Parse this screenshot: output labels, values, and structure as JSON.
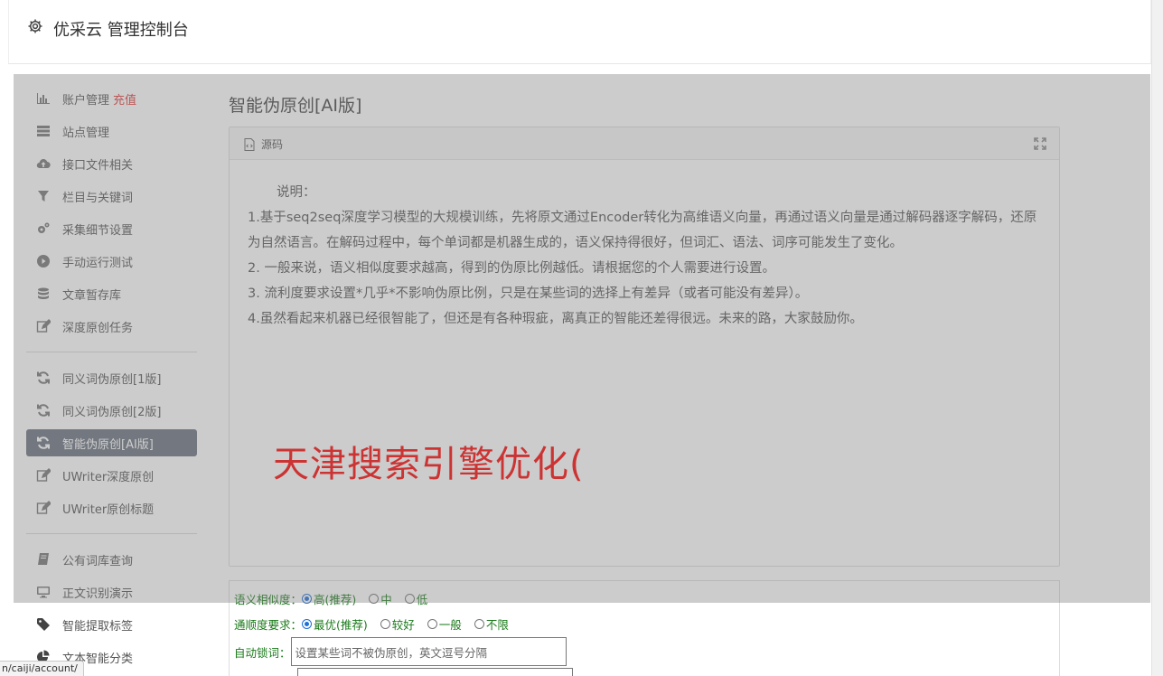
{
  "app": {
    "title": "优采云 管理控制台"
  },
  "sidebar": {
    "items": [
      {
        "label": "账户管理",
        "badge": "充值",
        "icon": "bar-chart-icon"
      },
      {
        "label": "站点管理",
        "icon": "server-icon"
      },
      {
        "label": "接口文件相关",
        "icon": "cloud-upload-icon"
      },
      {
        "label": "栏目与关键词",
        "icon": "filter-icon"
      },
      {
        "label": "采集细节设置",
        "icon": "cogs-icon"
      },
      {
        "label": "手动运行测试",
        "icon": "play-circle-icon"
      },
      {
        "label": "文章暂存库",
        "icon": "database-icon"
      },
      {
        "label": "深度原创任务",
        "icon": "edit-icon"
      },
      {
        "label": "同义词伪原创[1版]",
        "icon": "refresh-icon"
      },
      {
        "label": "同义词伪原创[2版]",
        "icon": "refresh-icon"
      },
      {
        "label": "智能伪原创[AI版]",
        "icon": "refresh-icon",
        "active": true
      },
      {
        "label": "UWriter深度原创",
        "icon": "edit-icon"
      },
      {
        "label": "UWriter原创标题",
        "icon": "edit-icon"
      },
      {
        "label": "公有词库查询",
        "icon": "book-icon"
      },
      {
        "label": "正文识别演示",
        "icon": "monitor-icon"
      },
      {
        "label": "智能提取标签",
        "icon": "tag-icon"
      },
      {
        "label": "文本智能分类",
        "icon": "pie-chart-icon"
      }
    ]
  },
  "main": {
    "title": "智能伪原创[AI版]",
    "panel": {
      "label": "源码",
      "intro": "说明：",
      "lines": [
        "1.基于seq2seq深度学习模型的大规模训练，先将原文通过Encoder转化为高维语义向量，再通过语义向量是通过解码器逐字解码，还原为自然语言。在解码过程中，每个单词都是机器生成的，语义保持得很好，但词汇、语法、词序可能发生了变化。",
        "2. 一般来说，语义相似度要求越高，得到的伪原比例越低。请根据您的个人需要进行设置。",
        "3. 流利度要求设置*几乎*不影响伪原比例，只是在某些词的选择上有差异（或者可能没有差异）。",
        "4.虽然看起来机器已经很智能了，但还是有各种瑕疵，离真正的智能还差得很远。未来的路，大家鼓励你。"
      ]
    },
    "watermark": "天津搜索引擎优化(",
    "form": {
      "similarity_label": "语义相似度：",
      "similarity_options": [
        "高(推荐)",
        "中",
        "低"
      ],
      "fluency_label": "通顺度要求：",
      "fluency_options": [
        "最优(推荐)",
        "较好",
        "一般",
        "不限"
      ],
      "lock_label": "自动锁词：",
      "lock_placeholder": "设置某些词不被伪原创，英文逗号分隔"
    }
  },
  "statusbar": {
    "url": "n/caiji/account/"
  },
  "colors": {
    "active_bg": "#6b7381",
    "accent_red": "#e23b3b",
    "form_label": "#1a7a1a",
    "watermark": "#ff0000"
  }
}
